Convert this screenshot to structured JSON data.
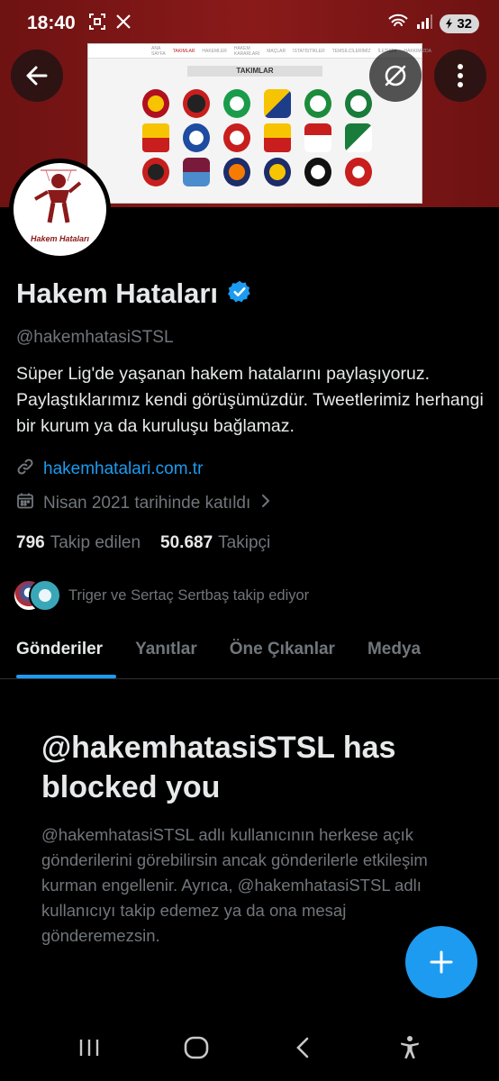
{
  "status_bar": {
    "time": "18:40",
    "battery": "32",
    "icons": [
      "scan-icon",
      "x-logo-icon",
      "wifi-icon",
      "signal-icon",
      "battery-icon"
    ]
  },
  "banner": {
    "title": "TAKIMLAR",
    "nav_items": [
      "ANA SAYFA",
      "TAKIMLAR",
      "HAKEMLER",
      "HAKEM KARARLARI",
      "MAÇLAR",
      "İSTATİSTİKLER",
      "TEMSİLCİLERİMİZ",
      "İLETİŞİM",
      "HAKKIMIZDA"
    ]
  },
  "avatar": {
    "caption": "Hakem Hataları"
  },
  "profile": {
    "name": "Hakem Hataları",
    "handle": "@hakemhatasiSTSL",
    "bio": "Süper Lig'de yaşanan hakem hatalarını paylaşıyoruz. Paylaştıklarımız kendi görüşümüzdür. Tweetlerimiz herhangi bir kurum ya da kuruluşu bağlamaz.",
    "website": "hakemhatalari.com.tr",
    "joined": "Nisan 2021 tarihinde katıldı",
    "following_count": "796",
    "following_label": "Takip edilen",
    "followers_count": "50.687",
    "followers_label": "Takipçi",
    "known_followers": "Triger ve Sertaç Sertbaş takip ediyor"
  },
  "tabs": [
    {
      "label": "Gönderiler",
      "active": true
    },
    {
      "label": "Yanıtlar",
      "active": false
    },
    {
      "label": "Öne Çıkanlar",
      "active": false
    },
    {
      "label": "Medya",
      "active": false
    }
  ],
  "blocked": {
    "title": "@hakemhatasiSTSL has blocked you",
    "description": "@hakemhatasiSTSL adlı kullanıcının herkese açık gönderilerini görebilirsin ancak gönderilerle etkileşim kurman engellenir. Ayrıca, @hakemhatasiSTSL adlı kullanıcıyı takip edemez ya da ona mesaj gönderemezsin."
  },
  "colors": {
    "accent": "#1d9bf0",
    "banner": "#8a1a1a",
    "muted_text": "#71767b"
  }
}
